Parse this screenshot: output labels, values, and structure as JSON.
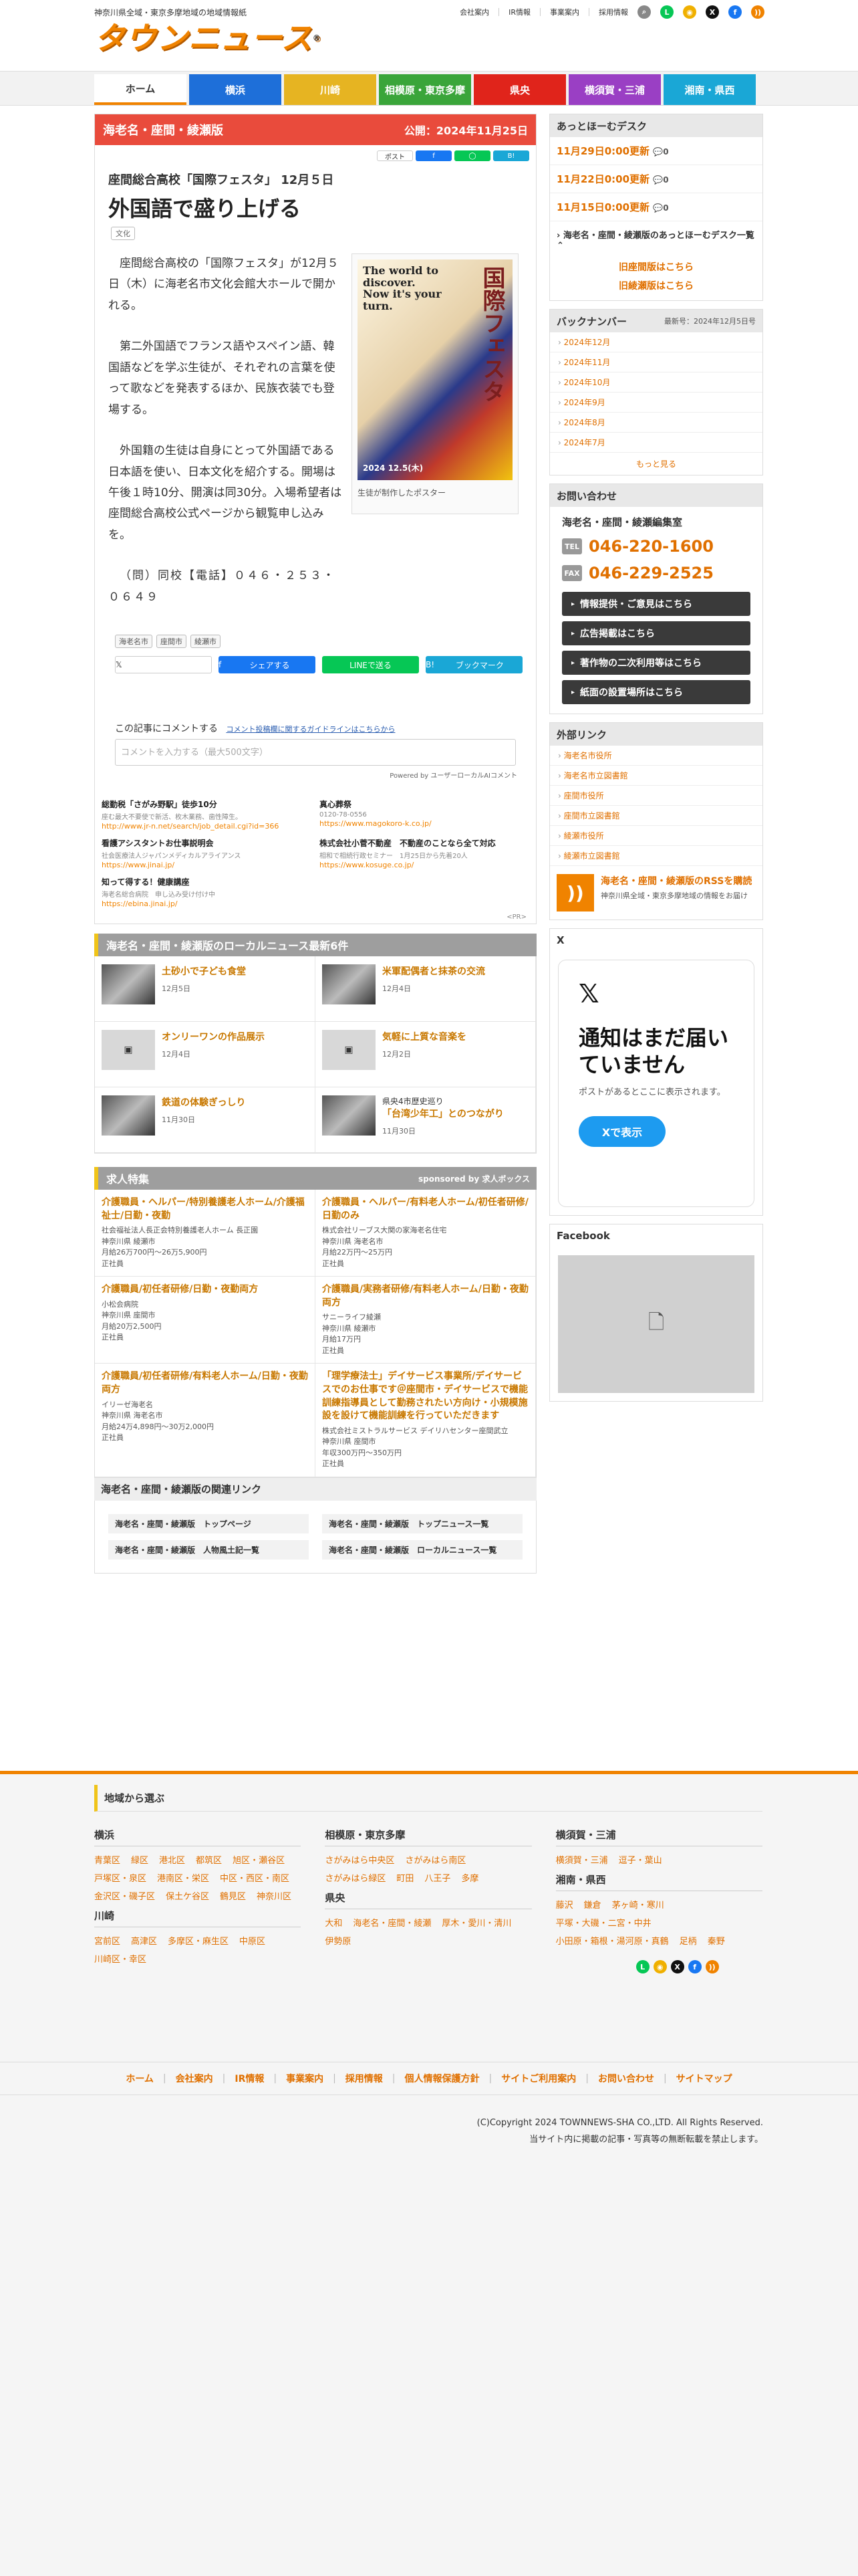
{
  "header": {
    "tagline": "神奈川県全域・東京多摩地域の地域情報紙",
    "logo": "タウンニュース",
    "top_links": [
      "会社案内",
      "IR情報",
      "事業案内",
      "採用情報"
    ]
  },
  "nav": [
    {
      "label": "ホーム",
      "color": "#ffffff"
    },
    {
      "label": "横浜",
      "color": "#1e6fd9"
    },
    {
      "label": "川崎",
      "color": "#e6b422"
    },
    {
      "label": "相模原・東京多摩",
      "color": "#3aa53a"
    },
    {
      "label": "県央",
      "color": "#e0241b"
    },
    {
      "label": "横須賀・三浦",
      "color": "#9a3fc4"
    },
    {
      "label": "湘南・県西",
      "color": "#1aa7d6"
    }
  ],
  "article": {
    "edition": "海老名・座間・綾瀬版",
    "published": "公開：2024年11月25日",
    "mini_share": [
      "ポスト",
      "シェア",
      "LINE",
      "B!"
    ],
    "subtitle": "座間総合高校「国際フェスタ」 12月５日",
    "title": "外国語で盛り上げる",
    "category": "文化",
    "paragraphs": [
      "座間総合高校の「国際フェスタ」が12月５日（木）に海老名市文化会館大ホールで開かれる。",
      "第二外国語でフランス語やスペイン語、韓国語などを学ぶ生徒が、それぞれの言葉を使って歌などを発表するほか、民族衣装でも登場する。",
      "外国籍の生徒は自身にとって外国語である日本語を使い、日本文化を紹介する。開場は午後１時10分、開演は同30分。入場希望者は座間総合高校公式ページから観覧申し込みを。"
    ],
    "contact": "（問）同校【電話】０４６・２５３・０６４９",
    "poster_text_en": "The world to discover. Now it's your turn.",
    "poster_text_jp": "国際フェスタ",
    "poster_text_date": "2024 12.5(木)",
    "poster_caption": "生徒が制作したポスター",
    "tags": [
      "海老名市",
      "座間市",
      "綾瀬市"
    ],
    "share": [
      "ポストする",
      "シェアする",
      "LINEで送る",
      "ブックマーク"
    ],
    "comment_label": "この記事にコメントする",
    "comment_guideline": "コメント投稿欄に関するガイドラインはこちらから",
    "comment_placeholder": "コメントを入力する（最大500文字）",
    "powered": "Powered by ユーザーローカルAIコメント"
  },
  "ads": [
    {
      "title": "総勤税「さがみ野駅」徒歩10分",
      "desc": "座む最大不要使で新活、枚木業務、歯性障生。",
      "url": "http://www.jr-n.net/search/job_detail.cgi?id=366"
    },
    {
      "title": "真心葬祭",
      "desc": "0120-78-0556",
      "url": "https://www.magokoro-k.co.jp/"
    },
    {
      "title": "看護アシスタントお仕事説明会",
      "desc": "社会医療法人ジャパンメディカルアライアンス",
      "url": "https://www.jinai.jp/"
    },
    {
      "title": "株式会社小菅不動産　不動産のことなら全て対応",
      "desc": "相和で相続行政セミナー　1月25日から先着20人",
      "url": "https://www.kosuge.co.jp/"
    },
    {
      "title": "知って得する！健康講座",
      "desc": "海老名総合病院　申し込み受け付け中",
      "url": "https://ebina.jinai.jp/"
    }
  ],
  "pr": "<PR>",
  "local_news": {
    "heading": "海老名・座間・綾瀬版のローカルニュース最新6件",
    "items": [
      {
        "title": "土砂小で子ども食堂",
        "date": "12月5日",
        "pre": ""
      },
      {
        "title": "米軍配偶者と抹茶の交流",
        "date": "12月4日",
        "pre": ""
      },
      {
        "title": "オンリーワンの作品展示",
        "date": "12月4日",
        "pre": ""
      },
      {
        "title": "気軽に上質な音楽を",
        "date": "12月2日",
        "pre": ""
      },
      {
        "title": "鉄道の体験ぎっしり",
        "date": "11月30日",
        "pre": ""
      },
      {
        "title": "「台湾少年工」とのつながり",
        "date": "11月30日",
        "pre": "県央4市歴史巡り"
      }
    ]
  },
  "jobs": {
    "heading": "求人特集",
    "sponsor": "sponsored by 求人ボックス",
    "items": [
      {
        "title": "介護職員・ヘルパー/特別養護老人ホーム/介護福祉士/日勤・夜勤",
        "meta": [
          "社会福祉法人長正会特別養護老人ホーム 長正園",
          "神奈川県 綾瀬市",
          "月給26万700円～26万5,900円",
          "正社員"
        ]
      },
      {
        "title": "介護職員・ヘルパー/有料老人ホーム/初任者研修/日勤のみ",
        "meta": [
          "株式会社リーブス大関の家海老名住宅",
          "神奈川県 海老名市",
          "月給22万円～25万円",
          "正社員"
        ]
      },
      {
        "title": "介護職員/初任者研修/日勤・夜勤両方",
        "meta": [
          "小松会病院",
          "神奈川県 座間市",
          "月給20万2,500円",
          "正社員"
        ]
      },
      {
        "title": "介護職員/実務者研修/有料老人ホーム/日勤・夜勤両方",
        "meta": [
          "サニーライフ綾瀬",
          "神奈川県 綾瀬市",
          "月給17万円",
          "正社員"
        ]
      },
      {
        "title": "介護職員/初任者研修/有料老人ホーム/日勤・夜勤両方",
        "meta": [
          "イリーゼ海老名",
          "神奈川県 海老名市",
          "月給24万4,898円～30万2,000円",
          "正社員"
        ]
      },
      {
        "title": "「理学療法士」デイサービス事業所/デイサービスでのお仕事です＠座間市・デイサービスで機能訓練指導員として勤務されたい方向け・小規模施設を設けて機能訓練を行っていただきます",
        "meta": [
          "株式会社ミストラルサービス デイリハセンター座間武立",
          "神奈川県 座間市",
          "年収300万円～350万円",
          "正社員"
        ]
      }
    ]
  },
  "related": {
    "heading": "海老名・座間・綾瀬版の関連リンク",
    "items": [
      "海老名・座間・綾瀬版　トップページ",
      "海老名・座間・綾瀬版　トップニュース一覧",
      "海老名・座間・綾瀬版　人物風土記一覧",
      "海老名・座間・綾瀬版　ローカルニュース一覧"
    ]
  },
  "sidebar": {
    "desk_title": "あっとほーむデスク",
    "desk_items": [
      {
        "date": "11月29日0:00更新",
        "count": "0"
      },
      {
        "date": "11月22日0:00更新",
        "count": "0"
      },
      {
        "date": "11月15日0:00更新",
        "count": "0"
      }
    ],
    "desk_link": "海老名・座間・綾瀬版のあっとほーむデスク一覧",
    "old_links": [
      "旧座間版はこちら",
      "旧綾瀬版はこちら"
    ],
    "back_title": "バックナンバー",
    "back_latest": "最新号：2024年12月5日号",
    "back_items": [
      "2024年12月",
      "2024年11月",
      "2024年10月",
      "2024年9月",
      "2024年8月",
      "2024年7月"
    ],
    "back_more": "もっと見る",
    "contact_title": "お問い合わせ",
    "contact_name": "海老名・座間・綾瀬編集室",
    "tel_label": "TEL",
    "tel": "046-220-1600",
    "fax_label": "FAX",
    "fax": "046-229-2525",
    "buttons": [
      "情報提供・ご意見はこちら",
      "広告掲載はこちら",
      "著作物の二次利用等はこちら",
      "紙面の設置場所はこちら"
    ],
    "ext_title": "外部リンク",
    "ext_items": [
      "海老名市役所",
      "海老名市立図書館",
      "座間市役所",
      "座間市立図書館",
      "綾瀬市役所",
      "綾瀬市立図書館"
    ],
    "rss_title": "海老名・座間・綾瀬版のRSSを購読",
    "rss_desc": "神奈川県全域・東京多摩地域の情報をお届け",
    "x_title": "X",
    "x_heading": "通知はまだ届いていません",
    "x_sub": "ポストがあるとここに表示されます。",
    "x_button": "Xで表示",
    "fb_title": "Facebook"
  },
  "footer": {
    "region_head": "地域から選ぶ",
    "columns": [
      {
        "groups": [
          {
            "title": "横浜",
            "links": [
              "青葉区",
              "緑区",
              "港北区",
              "都筑区",
              "旭区・瀬谷区",
              "戸塚区・泉区",
              "港南区・栄区",
              "中区・西区・南区",
              "金沢区・磯子区",
              "保土ケ谷区",
              "鶴見区",
              "神奈川区"
            ]
          },
          {
            "title": "川崎",
            "links": [
              "宮前区",
              "高津区",
              "多摩区・麻生区",
              "中原区",
              "川崎区・幸区"
            ]
          }
        ]
      },
      {
        "groups": [
          {
            "title": "相模原・東京多摩",
            "links": [
              "さがみはら中央区",
              "さがみはら南区",
              "さがみはら緑区",
              "町田",
              "八王子",
              "多摩"
            ]
          },
          {
            "title": "県央",
            "links": [
              "大和",
              "海老名・座間・綾瀬",
              "厚木・愛川・清川",
              "伊勢原"
            ]
          }
        ]
      },
      {
        "groups": [
          {
            "title": "横須賀・三浦",
            "links": [
              "横須賀・三浦",
              "逗子・葉山"
            ]
          },
          {
            "title": "湘南・県西",
            "links": [
              "藤沢",
              "鎌倉",
              "茅ヶ崎・寒川",
              "平塚・大磯・二宮・中井",
              "小田原・箱根・湯河原・真鶴",
              "足柄",
              "秦野"
            ]
          }
        ]
      }
    ],
    "nav": [
      "ホーム",
      "会社案内",
      "IR情報",
      "事業案内",
      "採用情報",
      "個人情報保護方針",
      "サイトご利用案内",
      "お問い合わせ",
      "サイトマップ"
    ],
    "copyright": "(C)Copyright 2024 TOWNNEWS-SHA CO.,LTD. All Rights Reserved.",
    "notice": "当サイト内に掲載の記事・写真等の無断転載を禁止します。"
  }
}
